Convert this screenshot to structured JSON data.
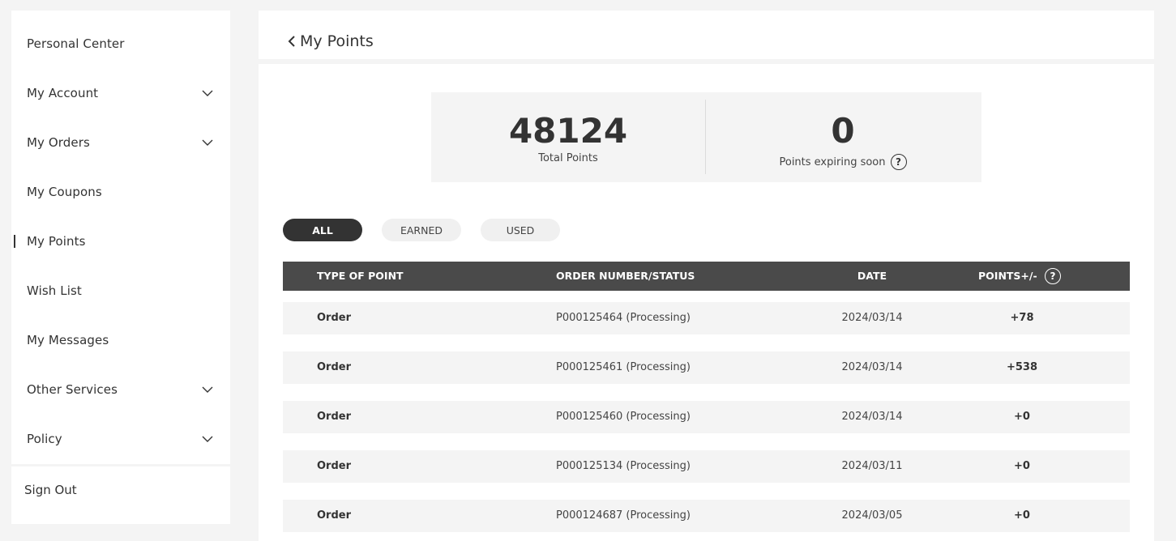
{
  "sidebar": {
    "items": [
      {
        "label": "Personal Center",
        "expandable": false
      },
      {
        "label": "My Account",
        "expandable": true
      },
      {
        "label": "My Orders",
        "expandable": true
      },
      {
        "label": "My Coupons",
        "expandable": false
      },
      {
        "label": "My Points",
        "expandable": false,
        "active": true
      },
      {
        "label": "Wish List",
        "expandable": false
      },
      {
        "label": "My Messages",
        "expandable": false
      },
      {
        "label": "Other Services",
        "expandable": true
      },
      {
        "label": "Policy",
        "expandable": true
      }
    ],
    "sign_out": "Sign Out"
  },
  "header": {
    "title": "My Points",
    "back_icon": "chevron-left-icon"
  },
  "summary": {
    "total_points": "48124",
    "total_points_label": "Total Points",
    "expiring_points": "0",
    "expiring_label": "Points expiring soon",
    "help_glyph": "?"
  },
  "filters": {
    "all": "ALL",
    "earned": "EARNED",
    "used": "USED",
    "selected": "ALL"
  },
  "table": {
    "headers": {
      "type": "TYPE OF POINT",
      "order": "ORDER NUMBER/STATUS",
      "date": "DATE",
      "points": "POINTS+/-"
    },
    "rows": [
      {
        "type": "Order",
        "order": "P000125464 (Processing)",
        "date": "2024/03/14",
        "points": "+78"
      },
      {
        "type": "Order",
        "order": "P000125461 (Processing)",
        "date": "2024/03/14",
        "points": "+538"
      },
      {
        "type": "Order",
        "order": "P000125460 (Processing)",
        "date": "2024/03/14",
        "points": "+0"
      },
      {
        "type": "Order",
        "order": "P000125134 (Processing)",
        "date": "2024/03/11",
        "points": "+0"
      },
      {
        "type": "Order",
        "order": "P000124687 (Processing)",
        "date": "2024/03/05",
        "points": "+0"
      }
    ]
  },
  "colors": {
    "background": "#f4f4f4",
    "panel": "#ffffff",
    "table_header": "#4a4a4a",
    "active_pill": "#333333"
  }
}
